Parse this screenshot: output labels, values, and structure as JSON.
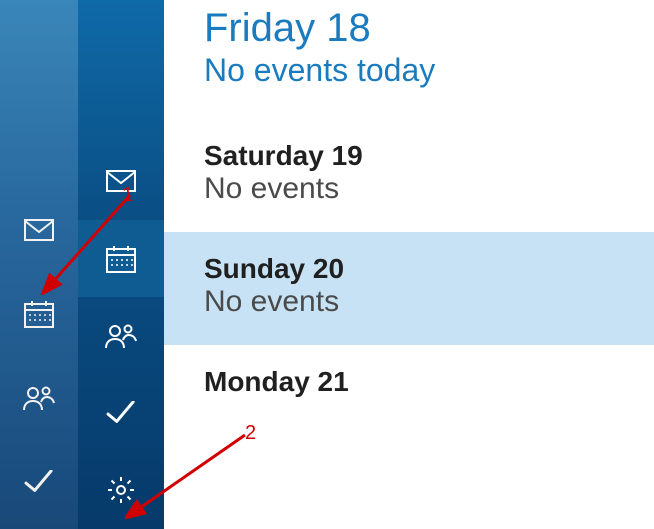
{
  "agenda": {
    "today": {
      "title": "Friday 18",
      "subtitle": "No events today"
    },
    "days": [
      {
        "title": "Saturday 19",
        "subtitle": "No events",
        "highlight": false
      },
      {
        "title": "Sunday 20",
        "subtitle": "No events",
        "highlight": true
      },
      {
        "title": "Monday 21",
        "subtitle": "",
        "highlight": false
      }
    ]
  },
  "nav_narrow": {
    "mail": "mail-icon",
    "calendar": "calendar-icon",
    "people": "people-icon",
    "todo": "todo-icon"
  },
  "nav_wide": {
    "mail": "mail-icon",
    "calendar": "calendar-icon",
    "people": "people-icon",
    "todo": "todo-icon",
    "settings": "settings-icon"
  },
  "annotations": {
    "a1": "1",
    "a2": "2"
  }
}
